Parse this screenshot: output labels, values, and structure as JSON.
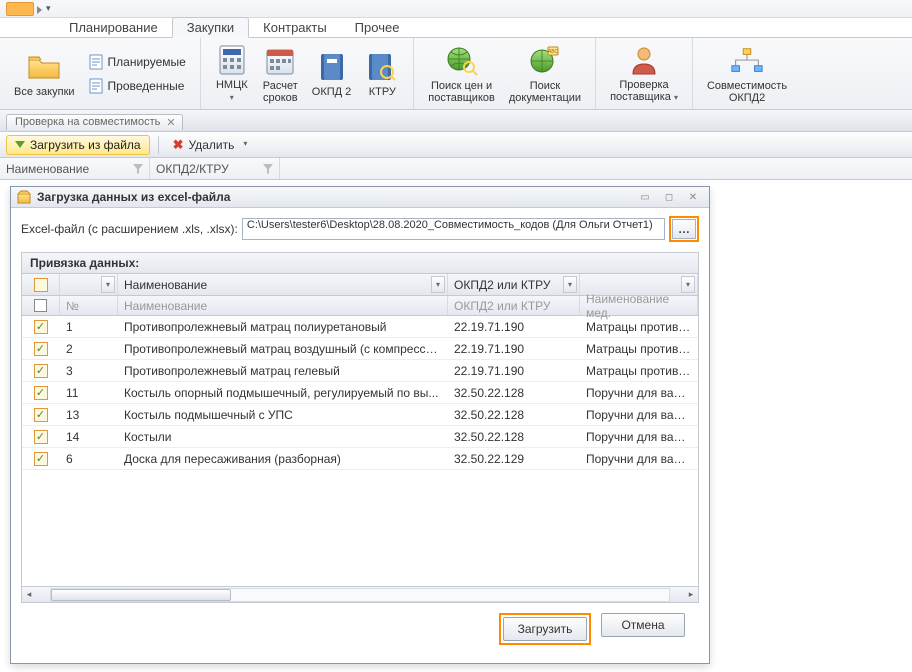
{
  "tabs": {
    "planning": "Планирование",
    "purchases": "Закупки",
    "contracts": "Контракты",
    "other": "Прочее"
  },
  "ribbon": {
    "all_purchases": "Все закупки",
    "planned": "Планируемые",
    "conducted": "Проведенные",
    "nmck": "НМЦК",
    "schedule": "Расчет\nсроков",
    "okpd2": "ОКПД 2",
    "ktru": "КТРУ",
    "price_search": "Поиск цен и\nпоставщиков",
    "doc_search": "Поиск\nдокументации",
    "supplier_check": "Проверка\nпоставщика",
    "compat": "Совместимость\nОКПД2"
  },
  "doc_tab": {
    "label": "Проверка на совместимость"
  },
  "toolbar": {
    "load_from_file": "Загрузить из файла",
    "delete": "Удалить"
  },
  "filter": {
    "name": "Наименование",
    "okpd": "ОКПД2/КТРУ"
  },
  "dialog": {
    "title": "Загрузка данных из excel-файла",
    "path_label": "Excel-файл (с расширением .xls, .xlsx):",
    "path_value": "C:\\Users\\tester6\\Desktop\\28.08.2020_Совместимость_кодов (Для Ольги Отчет1)",
    "group_title": "Привязка данных:",
    "head1": {
      "name": "Наименование",
      "code": "ОКПД2 или КТРУ"
    },
    "head2": {
      "num": "№",
      "name": "Наименование",
      "code": "ОКПД2 или КТРУ",
      "med": "Наименование мед."
    },
    "rows": [
      {
        "num": "1",
        "name": "Противопролежневый матрац полиуретановый",
        "code": "22.19.71.190",
        "med": "Матрацы противопр"
      },
      {
        "num": "2",
        "name": "Противопролежневый матрац воздушный (с компрессо...",
        "code": "22.19.71.190",
        "med": "Матрацы противопр"
      },
      {
        "num": "3",
        "name": "Противопролежневый матрац гелевый",
        "code": "22.19.71.190",
        "med": "Матрацы противопр"
      },
      {
        "num": "11",
        "name": "Костыль опорный подмышечный, регулируемый по вы...",
        "code": "32.50.22.128",
        "med": "Поручни для ванной"
      },
      {
        "num": "13",
        "name": "Костыль подмышечный с УПС",
        "code": "32.50.22.128",
        "med": "Поручни для ванной"
      },
      {
        "num": "14",
        "name": "Костыли",
        "code": "32.50.22.128",
        "med": "Поручни для ванной"
      },
      {
        "num": "6",
        "name": "Доска для пересаживания (разборная)",
        "code": "32.50.22.129",
        "med": "Поручни для ванной"
      }
    ],
    "load_btn": "Загрузить",
    "cancel_btn": "Отмена"
  }
}
